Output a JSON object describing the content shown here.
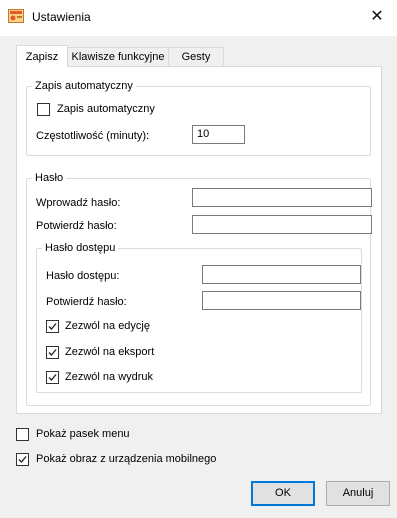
{
  "window": {
    "title": "Ustawienia",
    "close_symbol": "✕"
  },
  "tabs": [
    {
      "label": "Zapisz",
      "active": true
    },
    {
      "label": "Klawisze funkcyjne",
      "active": false
    },
    {
      "label": "Gesty",
      "active": false
    }
  ],
  "autosave": {
    "group_label": "Zapis automatyczny",
    "checkbox_label": "Zapis automatyczny",
    "checked": false,
    "frequency_label": "Częstotliwość (minuty):",
    "frequency_value": "10"
  },
  "password": {
    "group_label": "Hasło",
    "enter_label": "Wprowadź hasło:",
    "enter_value": "",
    "confirm_label": "Potwierdź hasło:",
    "confirm_value": "",
    "access": {
      "group_label": "Hasło dostępu",
      "access_label": "Hasło dostępu:",
      "access_value": "",
      "confirm_label": "Potwierdź hasło:",
      "confirm_value": "",
      "allow_edit_label": "Zezwól na edycję",
      "allow_edit_checked": true,
      "allow_export_label": "Zezwól na eksport",
      "allow_export_checked": true,
      "allow_print_label": "Zezwól na wydruk",
      "allow_print_checked": true
    }
  },
  "options": {
    "show_menu_label": "Pokaż pasek menu",
    "show_menu_checked": false,
    "show_mobile_label": "Pokaż obraz z urządzenia mobilnego",
    "show_mobile_checked": true
  },
  "buttons": {
    "ok_label": "OK",
    "cancel_label": "Anuluj"
  },
  "colors": {
    "accent": "#0078d7",
    "window_bg": "#f0f0f0"
  }
}
